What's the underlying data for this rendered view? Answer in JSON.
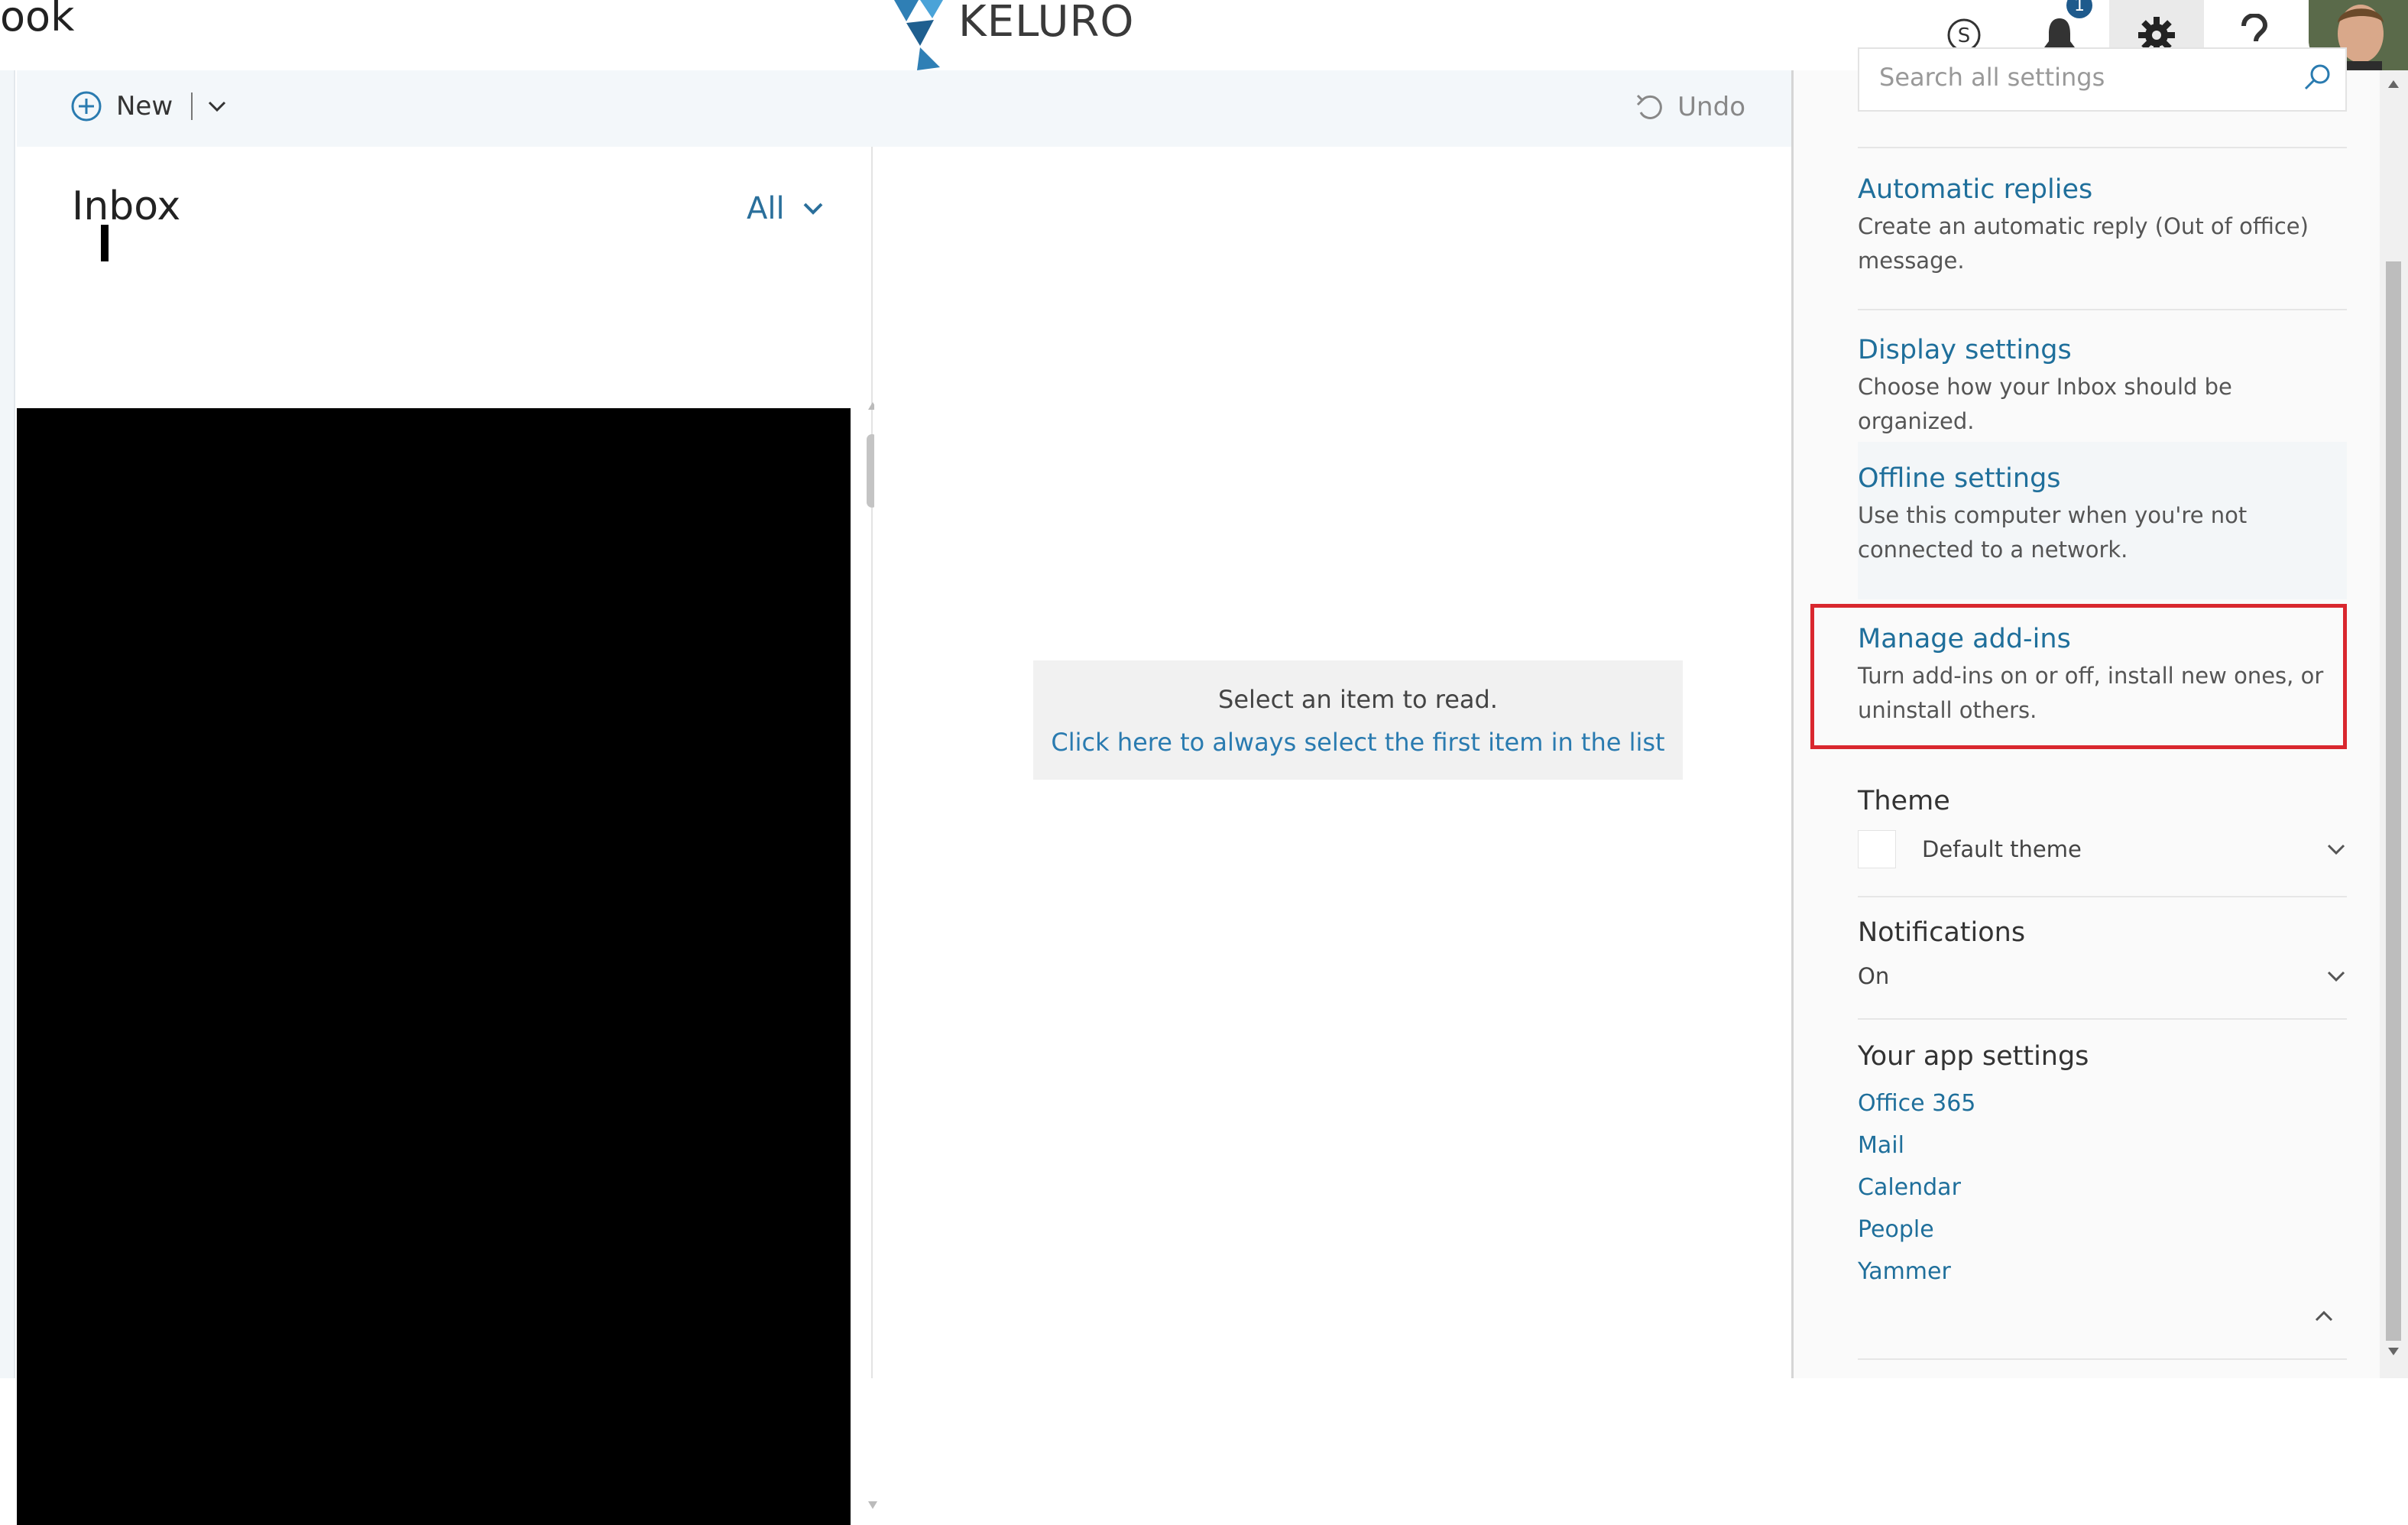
{
  "header": {
    "app_name_fragment": "ook",
    "logo_text": "KELURO",
    "notification_count": "1",
    "icons": [
      "skype-icon",
      "bell-icon",
      "gear-icon",
      "help-icon"
    ]
  },
  "toolbar": {
    "new_label": "New",
    "undo_label": "Undo"
  },
  "message_list": {
    "folder_title": "Inbox",
    "filter_label": "All"
  },
  "reading_pane": {
    "empty_title": "Select an item to read.",
    "empty_link": "Click here to always select the first item in the list"
  },
  "settings_panel": {
    "search_placeholder": "Search all settings",
    "automatic_replies": {
      "title": "Automatic replies",
      "desc": "Create an automatic reply (Out of office) message."
    },
    "display_settings": {
      "title": "Display settings",
      "desc": "Choose how your Inbox should be organized."
    },
    "offline_settings": {
      "title": "Offline settings",
      "desc": "Use this computer when you're not connected to a network."
    },
    "manage_addins": {
      "title": "Manage add-ins",
      "desc": "Turn add-ins on or off, install new ones, or uninstall others."
    },
    "theme": {
      "title": "Theme",
      "value": "Default theme"
    },
    "notifications": {
      "title": "Notifications",
      "value": "On"
    },
    "app_settings": {
      "title": "Your app settings",
      "links": [
        "Office 365",
        "Mail",
        "Calendar",
        "People",
        "Yammer"
      ]
    }
  },
  "colors": {
    "link": "#1f6f9b",
    "highlight_border": "#d9272e",
    "badge": "#1e5a8c",
    "command_bar": "#f3f7fa"
  }
}
